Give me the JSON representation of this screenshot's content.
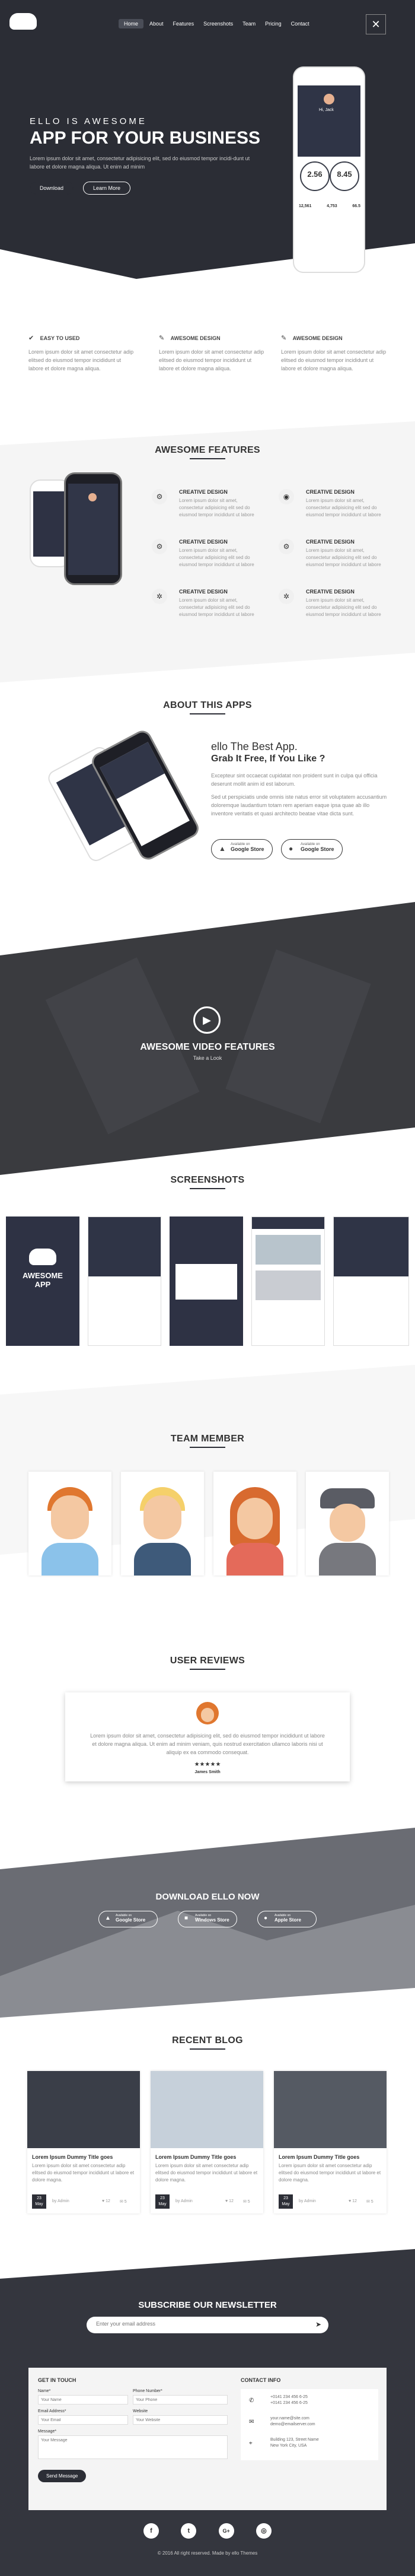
{
  "nav": {
    "items": [
      "Home",
      "About",
      "Features",
      "Screenshots",
      "Team",
      "Pricing",
      "Contact"
    ],
    "menu_icon": "close-icon"
  },
  "hero": {
    "kicker": "ELLO IS AWESOME",
    "title": "APP FOR YOUR BUSINESS",
    "desc": "Lorem ipsum dolor sit amet, consectetur adipisicing elit, sed do eiusmod tempor incidi-dunt ut labore et dolore magna aliqua. Ut enim ad minim",
    "btn_download": "Download",
    "btn_learn": "Learn More",
    "phone": {
      "greeting": "Hi, Jack",
      "stats": [
        {
          "value": "2.56",
          "unit": "Km"
        },
        {
          "value": "8.45",
          "unit": "Km"
        }
      ],
      "small": [
        {
          "value": "12,561",
          "unit": "Kcal"
        },
        {
          "value": "4,753",
          "unit": "Steps"
        },
        {
          "value": "66.5",
          "unit": "Kg"
        }
      ]
    }
  },
  "highlights": [
    {
      "icon": "check-icon",
      "title": "EASY TO USED",
      "desc": "Lorem ipsum dolor sit amet consectetur adip elitsed do eiusmod tempor incididunt ut labore et dolore magna aliqua."
    },
    {
      "icon": "pencil-icon",
      "title": "AWESOME DESIGN",
      "desc": "Lorem ipsum dolor sit amet consectetur adip elitsed do eiusmod tempor incididunt ut labore et dolore magna aliqua."
    },
    {
      "icon": "pencil-icon",
      "title": "AWESOME DESIGN",
      "desc": "Lorem ipsum dolor sit amet consectetur adip elitsed do eiusmod tempor incididunt ut labore et dolore magna aliqua."
    }
  ],
  "features": {
    "title": "AWESOME FEATURES",
    "items": [
      {
        "icon": "gear-icon",
        "title": "CREATIVE DESIGN",
        "desc": "Lorem ipsum dolor sit amet, consectetur adipisicing elit sed do eiusmod tempor incididunt ut labore"
      },
      {
        "icon": "eye-icon",
        "title": "CREATIVE DESIGN",
        "desc": "Lorem ipsum dolor sit amet, consectetur adipisicing elit sed do eiusmod tempor incididunt ut labore"
      },
      {
        "icon": "gear-icon",
        "title": "CREATIVE DESIGN",
        "desc": "Lorem ipsum dolor sit amet, consectetur adipisicing elit sed do eiusmod tempor incididunt ut labore"
      },
      {
        "icon": "gear-icon",
        "title": "CREATIVE DESIGN",
        "desc": "Lorem ipsum dolor sit amet, consectetur adipisicing elit sed do eiusmod tempor incididunt ut labore"
      },
      {
        "icon": "cogs-icon",
        "title": "CREATIVE DESIGN",
        "desc": "Lorem ipsum dolor sit amet, consectetur adipisicing elit sed do eiusmod tempor incididunt ut labore"
      },
      {
        "icon": "cogs-icon",
        "title": "CREATIVE DESIGN",
        "desc": "Lorem ipsum dolor sit amet, consectetur adipisicing elit sed do eiusmod tempor incididunt ut labore"
      }
    ]
  },
  "about": {
    "title": "ABOUT THIS APPS",
    "heading1": "ello The Best App.",
    "heading2": "Grab It Free, If You Like ?",
    "p1": "Excepteur sint occaecat cupidatat non proident sunt in culpa qui officia deserunt mollit anim id est laborum.",
    "p2": "Sed ut perspiciatis unde omnis iste natus error sit voluptatem accusantium doloremque laudantium totam rem aperiam eaque ipsa quae ab illo inventore veritatis et quasi architecto beatae vitae dicta sunt.",
    "store1_small": "Available on",
    "store1": "Google Store",
    "store2_small": "Available on",
    "store2": "Google Store"
  },
  "video": {
    "title": "AWESOME VIDEO FEATURES",
    "sub": "Take a Look",
    "icon": "play-icon"
  },
  "screenshots": {
    "title": "SCREENSHOTS",
    "splash_line1": "AWESOME",
    "splash_line2": "APP"
  },
  "team": {
    "title": "TEAM MEMBER"
  },
  "reviews": {
    "title": "USER REVIEWS",
    "text": "Lorem ipsum dolor sit amet, consectetur adipisicing elit, sed do eiusmod tempor incididunt ut labore et dolore magna aliqua. Ut enim ad minim veniam, quis nostrud exercitation ullamco laboris nisi ut aliquip ex ea commodo consequat.",
    "stars": "★★★★★",
    "author": "James Smith"
  },
  "download": {
    "title": "DOWNLOAD ELLO NOW",
    "btns": [
      {
        "small": "Available on",
        "label": "Google Store"
      },
      {
        "small": "Available on",
        "label": "Windows Store"
      },
      {
        "small": "Available on",
        "label": "Apple Store"
      }
    ]
  },
  "blog": {
    "title": "RECENT BLOG",
    "posts": [
      {
        "title": "Lorem Ipsum Dummy Title goes",
        "desc": "Lorem ipsum dolor sit amet consectetur adip elitsed do eiusmod tempor incididunt ut labore et dolore magna.",
        "day": "23",
        "month": "May",
        "author": "by Admin",
        "likes": "♥ 12",
        "comments": "✉ 5"
      },
      {
        "title": "Lorem Ipsum Dummy Title goes",
        "desc": "Lorem ipsum dolor sit amet consectetur adip elitsed do eiusmod tempor incididunt ut labore et dolore magna.",
        "day": "23",
        "month": "May",
        "author": "by Admin",
        "likes": "♥ 12",
        "comments": "✉ 5"
      },
      {
        "title": "Lorem Ipsum Dummy Title goes",
        "desc": "Lorem ipsum dolor sit amet consectetur adip elitsed do eiusmod tempor incididunt ut labore et dolore magna.",
        "day": "23",
        "month": "May",
        "author": "by Admin",
        "likes": "♥ 12",
        "comments": "✉ 5"
      }
    ]
  },
  "newsletter": {
    "title": "SUBSCRIBE OUR NEWSLETTER",
    "placeholder": "Enter your email address",
    "icon": "send-icon"
  },
  "contact": {
    "form_title": "GET IN TOUCH",
    "name_label": "Name*",
    "name_ph": "Your Name",
    "phone_label": "Phone Number*",
    "phone_ph": "Your Phone",
    "email_label": "Email Address*",
    "email_ph": "Your Email",
    "website_label": "Website",
    "website_ph": "Your Website",
    "message_label": "Message*",
    "message_ph": "Your Message",
    "send": "Send Message",
    "info_title": "CONTACT INFO",
    "phone1": "+0141 234 456 6-25",
    "phone2": "+0141 234 456 6-25",
    "email1": "your.name@site.com",
    "email2": "demo@emailserver.com",
    "addr1": "Building 123, Street Name",
    "addr2": "New York City, USA"
  },
  "footer": {
    "copyright": "© 2016 All right reserved. Made by ello Themes"
  },
  "colors": {
    "dark": "#2c2e36",
    "accent": "#3b3f4b"
  }
}
